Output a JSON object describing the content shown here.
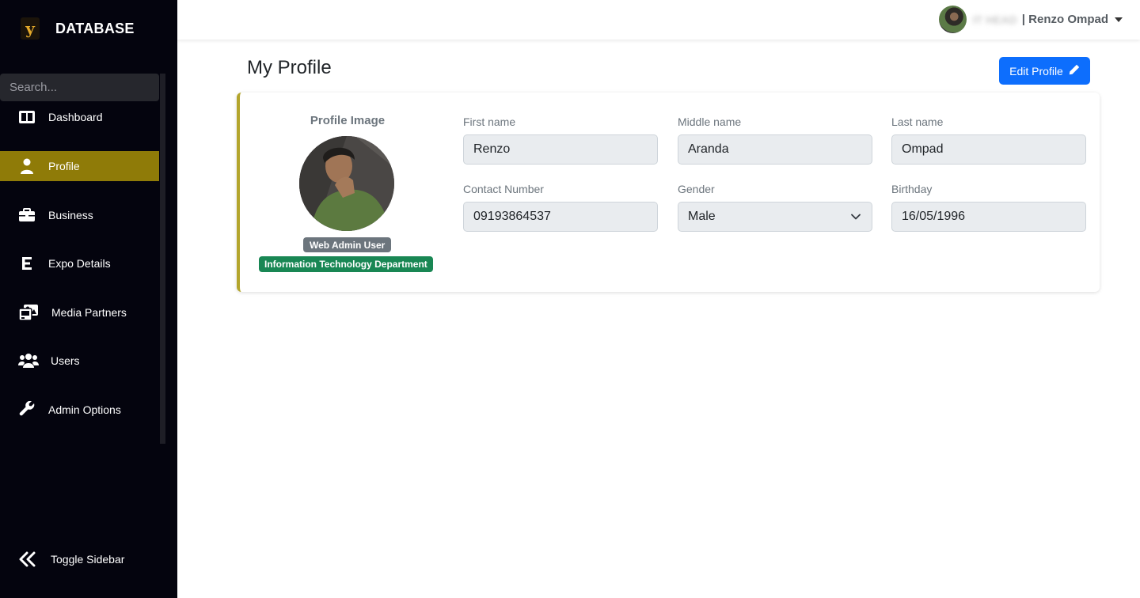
{
  "sidebar": {
    "brand_logo_letter": "y",
    "brand_title": "DATABASE",
    "search_placeholder": "Search...",
    "items": [
      {
        "label": "Dashboard",
        "icon": "dashboard-columns-icon",
        "active": false
      },
      {
        "label": "Profile",
        "icon": "user-icon",
        "active": true
      },
      {
        "label": "Business",
        "icon": "briefcase-icon",
        "active": false
      },
      {
        "label": "Expo Details",
        "icon": "letter-e-icon",
        "active": false
      },
      {
        "label": "Media Partners",
        "icon": "photo-gallery-icon",
        "active": false
      },
      {
        "label": "Users",
        "icon": "users-group-icon",
        "active": false
      },
      {
        "label": "Admin Options",
        "icon": "wrench-icon",
        "active": false
      }
    ],
    "toggle_label": "Toggle Sidebar",
    "colors": {
      "background": "#04040e",
      "active": "#8f7b08"
    }
  },
  "header": {
    "user_role": "IT HEAD",
    "user_name": "| Renzo Ompad"
  },
  "main": {
    "page_title": "My Profile",
    "edit_button_label": "Edit Profile",
    "profile": {
      "heading": "Profile Image",
      "role_badge": "Web Admin User",
      "department_badge": "Information Technology Department"
    },
    "fields": {
      "first_name": {
        "label": "First name",
        "value": "Renzo"
      },
      "middle_name": {
        "label": "Middle name",
        "value": "Aranda"
      },
      "last_name": {
        "label": "Last name",
        "value": "Ompad"
      },
      "contact_number": {
        "label": "Contact Number",
        "value": "09193864537"
      },
      "gender": {
        "label": "Gender",
        "value": "Male"
      },
      "birthday": {
        "label": "Birthday",
        "value": "16/05/1996"
      }
    },
    "colors": {
      "primary": "#0d6efd",
      "card_accent": "#b3a52c",
      "success": "#198754",
      "secondary": "#6c757d"
    }
  }
}
